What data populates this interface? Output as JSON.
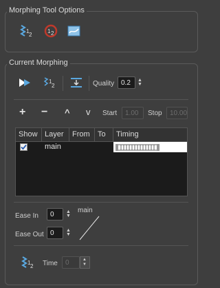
{
  "morphing_tool_options": {
    "title": "Morphing Tool Options",
    "icons": [
      "morph-tool-icon",
      "hint-point-icon",
      "morphing-settings-icon"
    ]
  },
  "current_morphing": {
    "title": "Current Morphing",
    "quality_label": "Quality",
    "quality_value": "0.2",
    "timeline_buttons": {
      "add": "+",
      "remove": "−",
      "up": "^",
      "down": "v"
    },
    "start_label": "Start",
    "start_value": "1.00",
    "stop_label": "Stop",
    "stop_value": "10.00",
    "table": {
      "columns": [
        "Show",
        "Layer",
        "From",
        "To",
        "Timing"
      ],
      "rows": [
        {
          "show": true,
          "layer": "main",
          "from": "",
          "to": ""
        }
      ]
    },
    "ease_in_label": "Ease In",
    "ease_in_value": "0",
    "ease_out_label": "Ease Out",
    "ease_out_value": "0",
    "curve_label": "main",
    "time_label": "Time",
    "time_value": "0"
  },
  "colors": {
    "panel_bg": "#3e3e3e",
    "field_bg": "#1b1b1b",
    "accent_blue": "#5aa8e0",
    "accent_red": "#c0392b"
  }
}
